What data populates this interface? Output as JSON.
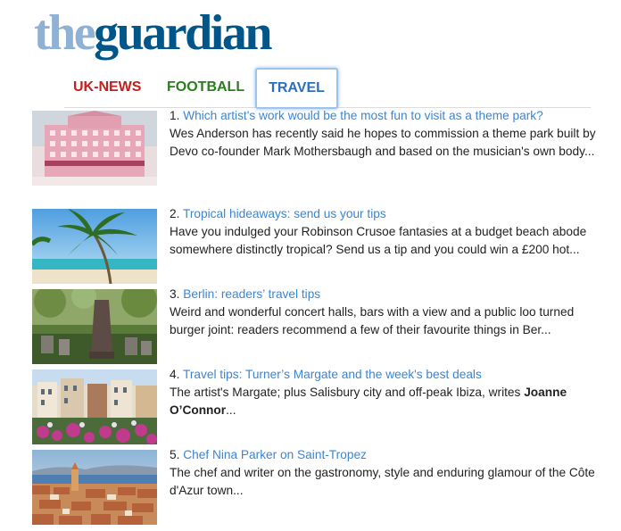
{
  "logo": {
    "part1": "the",
    "part2": "guardian"
  },
  "colors": {
    "logo_light": "#8fb1d5",
    "logo_dark": "#005689",
    "uk_news": "#c4201d",
    "football": "#2b7d1e",
    "travel": "#2a6fc0",
    "link": "#3a86d6"
  },
  "tabs": [
    {
      "label": "UK-NEWS"
    },
    {
      "label": "FOOTBALL"
    },
    {
      "label": "TRAVEL"
    }
  ],
  "articles": [
    {
      "number": "1.",
      "headline": "Which artist's work would be the most fun to visit as a theme park?",
      "standfirst": "Wes Anderson has recently said he hopes to commission a theme park built by Devo co-founder Mark Mothersbaugh and based on the musician's own body...",
      "image": "pink-hotel-image"
    },
    {
      "number": "2.",
      "headline": "Tropical hideaways: send us your tips",
      "standfirst": "Have you indulged your Robinson Crusoe fantasies at a budget beach abode somewhere distinctly tropical? Send us a tip and you could win a £200 hot...",
      "image": "palm-beach-image"
    },
    {
      "number": "3.",
      "headline": "Berlin: readers’ travel tips",
      "standfirst": "Weird and wonderful concert halls, bars with a view and a public loo turned burger joint: readers recommend a few of their favourite things in Ber...",
      "image": "cemetery-image"
    },
    {
      "number": "4.",
      "headline": "Travel tips: Turner’s Margate and the week's best deals",
      "standfirst": "The artist's Margate; plus Salisbury city and off-peak Ibiza, writes ",
      "author": "Joanne O’Connor",
      "trail": "...",
      "image": "margate-image"
    },
    {
      "number": "5.",
      "headline": "Chef Nina Parker on Saint-Tropez",
      "standfirst": "The chef and writer on the gastronomy, style and enduring glamour of the Côte d'Azur town...",
      "image": "saint-tropez-image"
    }
  ]
}
